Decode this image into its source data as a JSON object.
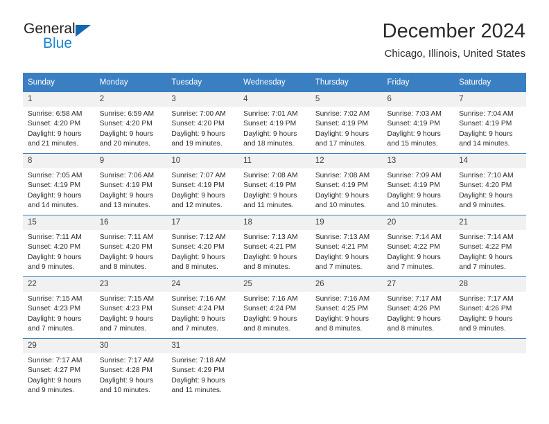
{
  "logo": {
    "word_one": "General",
    "word_two": "Blue",
    "triangle_icon": "triangle-icon",
    "brand_dark": "#231f20",
    "brand_blue": "#1a84d6"
  },
  "header": {
    "title": "December 2024",
    "subtitle": "Chicago, Illinois, United States"
  },
  "colors": {
    "header_band": "#3a7fc1",
    "day_number_band": "#f1f1f1",
    "text": "#2b2b2b"
  },
  "calendar": {
    "weekday_headers": [
      "Sunday",
      "Monday",
      "Tuesday",
      "Wednesday",
      "Thursday",
      "Friday",
      "Saturday"
    ],
    "weeks": [
      [
        {
          "day": "1",
          "sunrise": "Sunrise: 6:58 AM",
          "sunset": "Sunset: 4:20 PM",
          "daylight_line1": "Daylight: 9 hours",
          "daylight_line2": "and 21 minutes."
        },
        {
          "day": "2",
          "sunrise": "Sunrise: 6:59 AM",
          "sunset": "Sunset: 4:20 PM",
          "daylight_line1": "Daylight: 9 hours",
          "daylight_line2": "and 20 minutes."
        },
        {
          "day": "3",
          "sunrise": "Sunrise: 7:00 AM",
          "sunset": "Sunset: 4:20 PM",
          "daylight_line1": "Daylight: 9 hours",
          "daylight_line2": "and 19 minutes."
        },
        {
          "day": "4",
          "sunrise": "Sunrise: 7:01 AM",
          "sunset": "Sunset: 4:19 PM",
          "daylight_line1": "Daylight: 9 hours",
          "daylight_line2": "and 18 minutes."
        },
        {
          "day": "5",
          "sunrise": "Sunrise: 7:02 AM",
          "sunset": "Sunset: 4:19 PM",
          "daylight_line1": "Daylight: 9 hours",
          "daylight_line2": "and 17 minutes."
        },
        {
          "day": "6",
          "sunrise": "Sunrise: 7:03 AM",
          "sunset": "Sunset: 4:19 PM",
          "daylight_line1": "Daylight: 9 hours",
          "daylight_line2": "and 15 minutes."
        },
        {
          "day": "7",
          "sunrise": "Sunrise: 7:04 AM",
          "sunset": "Sunset: 4:19 PM",
          "daylight_line1": "Daylight: 9 hours",
          "daylight_line2": "and 14 minutes."
        }
      ],
      [
        {
          "day": "8",
          "sunrise": "Sunrise: 7:05 AM",
          "sunset": "Sunset: 4:19 PM",
          "daylight_line1": "Daylight: 9 hours",
          "daylight_line2": "and 14 minutes."
        },
        {
          "day": "9",
          "sunrise": "Sunrise: 7:06 AM",
          "sunset": "Sunset: 4:19 PM",
          "daylight_line1": "Daylight: 9 hours",
          "daylight_line2": "and 13 minutes."
        },
        {
          "day": "10",
          "sunrise": "Sunrise: 7:07 AM",
          "sunset": "Sunset: 4:19 PM",
          "daylight_line1": "Daylight: 9 hours",
          "daylight_line2": "and 12 minutes."
        },
        {
          "day": "11",
          "sunrise": "Sunrise: 7:08 AM",
          "sunset": "Sunset: 4:19 PM",
          "daylight_line1": "Daylight: 9 hours",
          "daylight_line2": "and 11 minutes."
        },
        {
          "day": "12",
          "sunrise": "Sunrise: 7:08 AM",
          "sunset": "Sunset: 4:19 PM",
          "daylight_line1": "Daylight: 9 hours",
          "daylight_line2": "and 10 minutes."
        },
        {
          "day": "13",
          "sunrise": "Sunrise: 7:09 AM",
          "sunset": "Sunset: 4:19 PM",
          "daylight_line1": "Daylight: 9 hours",
          "daylight_line2": "and 10 minutes."
        },
        {
          "day": "14",
          "sunrise": "Sunrise: 7:10 AM",
          "sunset": "Sunset: 4:20 PM",
          "daylight_line1": "Daylight: 9 hours",
          "daylight_line2": "and 9 minutes."
        }
      ],
      [
        {
          "day": "15",
          "sunrise": "Sunrise: 7:11 AM",
          "sunset": "Sunset: 4:20 PM",
          "daylight_line1": "Daylight: 9 hours",
          "daylight_line2": "and 9 minutes."
        },
        {
          "day": "16",
          "sunrise": "Sunrise: 7:11 AM",
          "sunset": "Sunset: 4:20 PM",
          "daylight_line1": "Daylight: 9 hours",
          "daylight_line2": "and 8 minutes."
        },
        {
          "day": "17",
          "sunrise": "Sunrise: 7:12 AM",
          "sunset": "Sunset: 4:20 PM",
          "daylight_line1": "Daylight: 9 hours",
          "daylight_line2": "and 8 minutes."
        },
        {
          "day": "18",
          "sunrise": "Sunrise: 7:13 AM",
          "sunset": "Sunset: 4:21 PM",
          "daylight_line1": "Daylight: 9 hours",
          "daylight_line2": "and 8 minutes."
        },
        {
          "day": "19",
          "sunrise": "Sunrise: 7:13 AM",
          "sunset": "Sunset: 4:21 PM",
          "daylight_line1": "Daylight: 9 hours",
          "daylight_line2": "and 7 minutes."
        },
        {
          "day": "20",
          "sunrise": "Sunrise: 7:14 AM",
          "sunset": "Sunset: 4:22 PM",
          "daylight_line1": "Daylight: 9 hours",
          "daylight_line2": "and 7 minutes."
        },
        {
          "day": "21",
          "sunrise": "Sunrise: 7:14 AM",
          "sunset": "Sunset: 4:22 PM",
          "daylight_line1": "Daylight: 9 hours",
          "daylight_line2": "and 7 minutes."
        }
      ],
      [
        {
          "day": "22",
          "sunrise": "Sunrise: 7:15 AM",
          "sunset": "Sunset: 4:23 PM",
          "daylight_line1": "Daylight: 9 hours",
          "daylight_line2": "and 7 minutes."
        },
        {
          "day": "23",
          "sunrise": "Sunrise: 7:15 AM",
          "sunset": "Sunset: 4:23 PM",
          "daylight_line1": "Daylight: 9 hours",
          "daylight_line2": "and 7 minutes."
        },
        {
          "day": "24",
          "sunrise": "Sunrise: 7:16 AM",
          "sunset": "Sunset: 4:24 PM",
          "daylight_line1": "Daylight: 9 hours",
          "daylight_line2": "and 7 minutes."
        },
        {
          "day": "25",
          "sunrise": "Sunrise: 7:16 AM",
          "sunset": "Sunset: 4:24 PM",
          "daylight_line1": "Daylight: 9 hours",
          "daylight_line2": "and 8 minutes."
        },
        {
          "day": "26",
          "sunrise": "Sunrise: 7:16 AM",
          "sunset": "Sunset: 4:25 PM",
          "daylight_line1": "Daylight: 9 hours",
          "daylight_line2": "and 8 minutes."
        },
        {
          "day": "27",
          "sunrise": "Sunrise: 7:17 AM",
          "sunset": "Sunset: 4:26 PM",
          "daylight_line1": "Daylight: 9 hours",
          "daylight_line2": "and 8 minutes."
        },
        {
          "day": "28",
          "sunrise": "Sunrise: 7:17 AM",
          "sunset": "Sunset: 4:26 PM",
          "daylight_line1": "Daylight: 9 hours",
          "daylight_line2": "and 9 minutes."
        }
      ],
      [
        {
          "day": "29",
          "sunrise": "Sunrise: 7:17 AM",
          "sunset": "Sunset: 4:27 PM",
          "daylight_line1": "Daylight: 9 hours",
          "daylight_line2": "and 9 minutes."
        },
        {
          "day": "30",
          "sunrise": "Sunrise: 7:17 AM",
          "sunset": "Sunset: 4:28 PM",
          "daylight_line1": "Daylight: 9 hours",
          "daylight_line2": "and 10 minutes."
        },
        {
          "day": "31",
          "sunrise": "Sunrise: 7:18 AM",
          "sunset": "Sunset: 4:29 PM",
          "daylight_line1": "Daylight: 9 hours",
          "daylight_line2": "and 11 minutes."
        },
        {
          "day": "",
          "sunrise": "",
          "sunset": "",
          "daylight_line1": "",
          "daylight_line2": ""
        },
        {
          "day": "",
          "sunrise": "",
          "sunset": "",
          "daylight_line1": "",
          "daylight_line2": ""
        },
        {
          "day": "",
          "sunrise": "",
          "sunset": "",
          "daylight_line1": "",
          "daylight_line2": ""
        },
        {
          "day": "",
          "sunrise": "",
          "sunset": "",
          "daylight_line1": "",
          "daylight_line2": ""
        }
      ]
    ]
  }
}
